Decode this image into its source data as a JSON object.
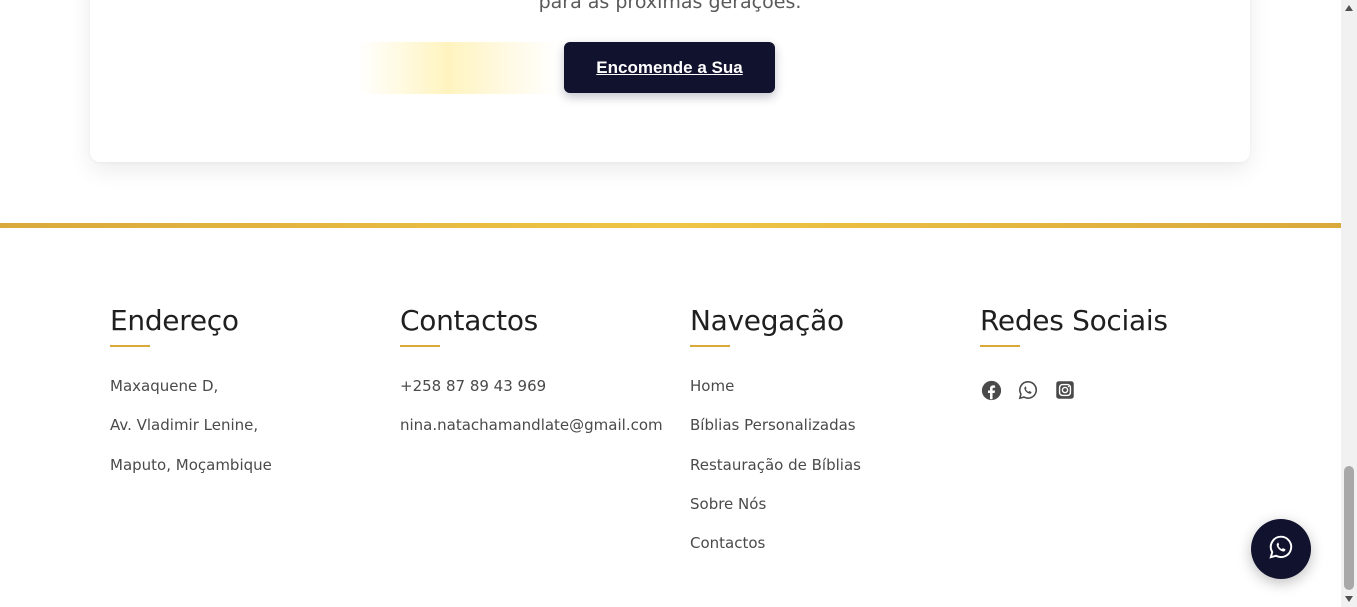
{
  "cta": {
    "tail_text": "para as próximas gerações.",
    "button_label": "Encomende a Sua"
  },
  "footer": {
    "endereco": {
      "title": "Endereço",
      "lines": [
        "Maxaquene D,",
        "Av. Vladimir Lenine,",
        "Maputo, Moçambique"
      ]
    },
    "contactos": {
      "title": "Contactos",
      "phone": "+258 87 89 43 969",
      "email": "nina.natachamandlate@gmail.com"
    },
    "navegacao": {
      "title": "Navegação",
      "items": [
        "Home",
        "Bíblias Personalizadas",
        "Restauração de Bíblias",
        "Sobre Nós",
        "Contactos"
      ]
    },
    "redes": {
      "title": "Redes Sociais",
      "icons": [
        "facebook-icon",
        "whatsapp-icon",
        "instagram-icon"
      ]
    }
  },
  "floating": {
    "icon": "whatsapp-icon"
  },
  "colors": {
    "brand_dark": "#11122e",
    "accent_gold": "#d9a93b",
    "text": "#4a4a4a"
  }
}
